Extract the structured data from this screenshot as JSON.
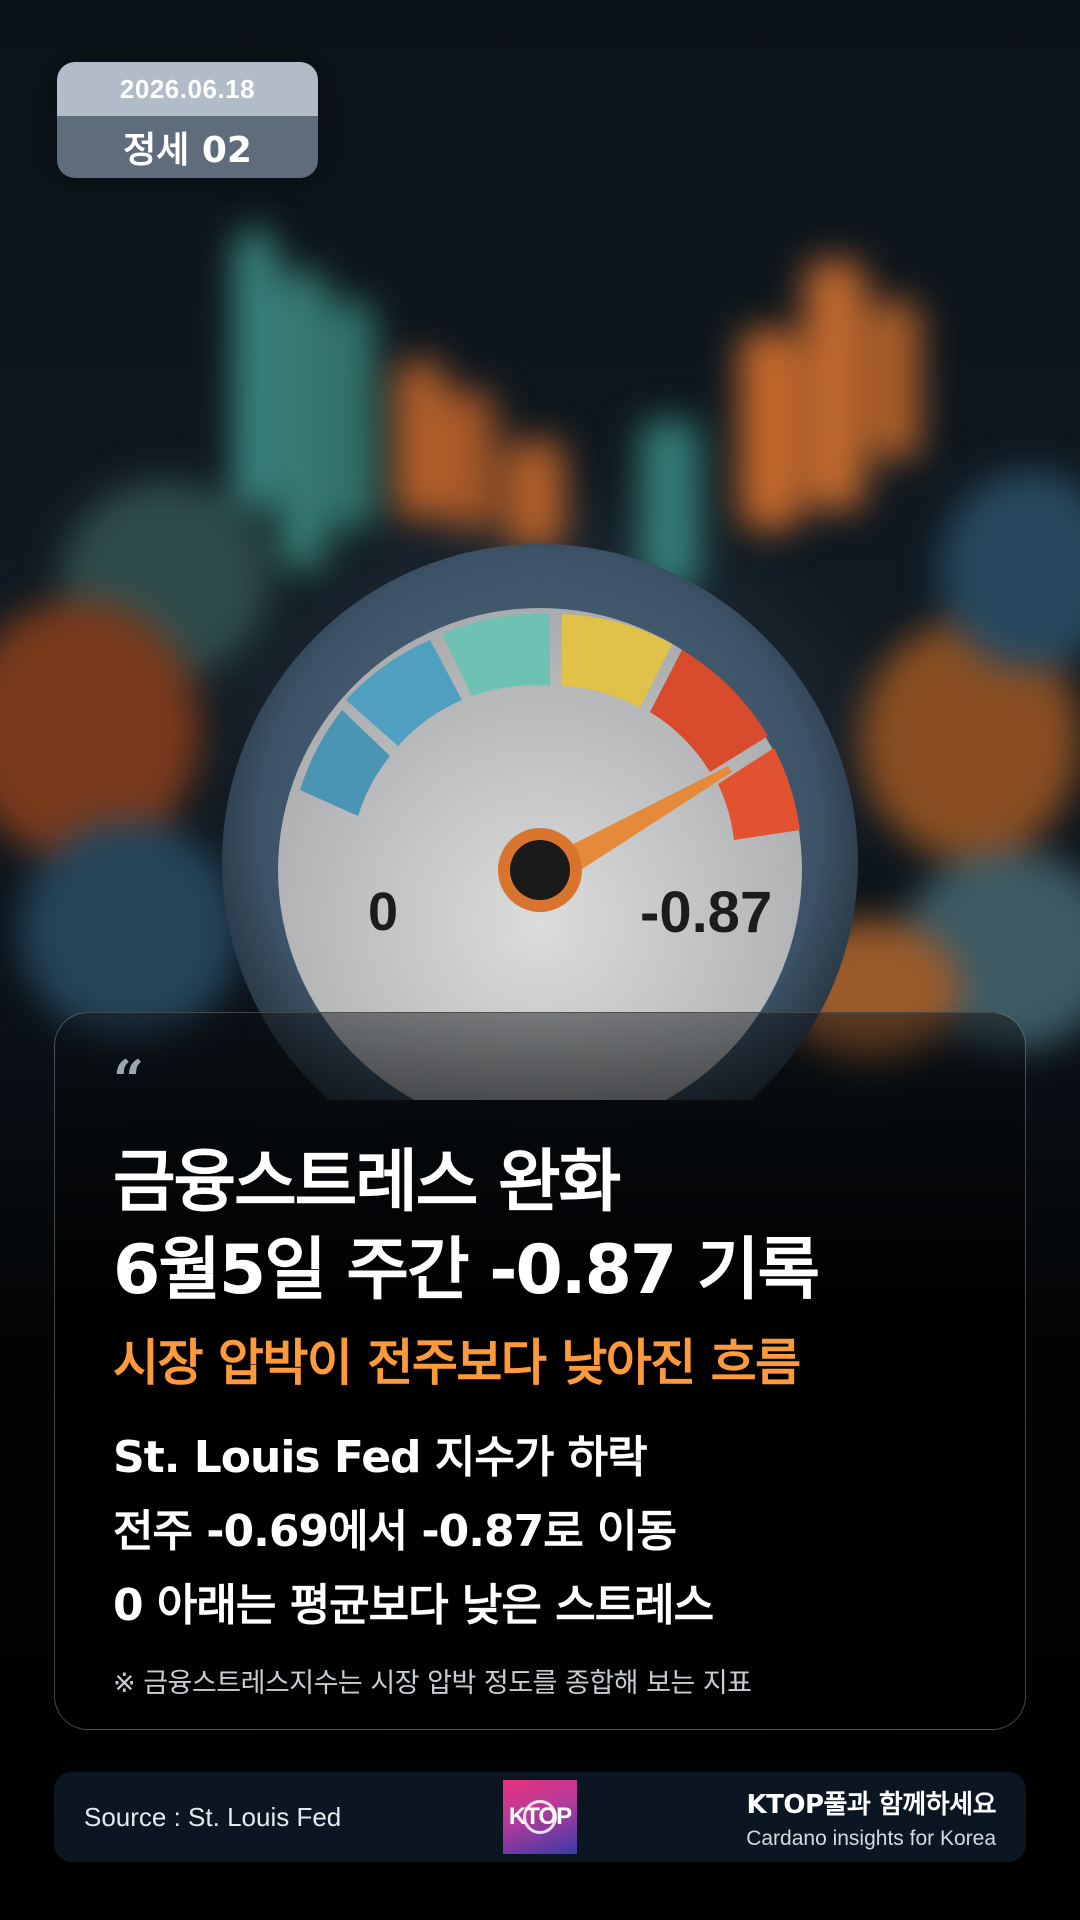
{
  "badge": {
    "date": "2026.06.18",
    "label": "정세 02"
  },
  "gauge": {
    "left_label": "0",
    "right_label": "-0.87"
  },
  "card": {
    "quote_mark": "“",
    "headline_lines": [
      "금융스트레스 완화",
      "6월5일 주간 -0.87 기록"
    ],
    "subheadline": "시장 압박이 전주보다 낮아진 흐름",
    "body_lines": [
      "St. Louis Fed 지수가 하락",
      "전주 -0.69에서 -0.87로 이동",
      "0 아래는 평균보다 낮은 스트레스"
    ],
    "footnote": "※ 금융스트레스지수는 시장 압박 정도를 종합해 보는 지표"
  },
  "footer": {
    "source": "Source : St. Louis Fed",
    "logo_text": "KTOP",
    "brand_title": "KTOP풀과 함께하세요",
    "brand_subtitle": "Cardano insights for Korea"
  },
  "colors": {
    "accent_orange": "#ff9a3c",
    "badge_top": "#b2bcc8",
    "badge_bottom": "#5f6c7c",
    "footer_bg": "#0b1622"
  }
}
